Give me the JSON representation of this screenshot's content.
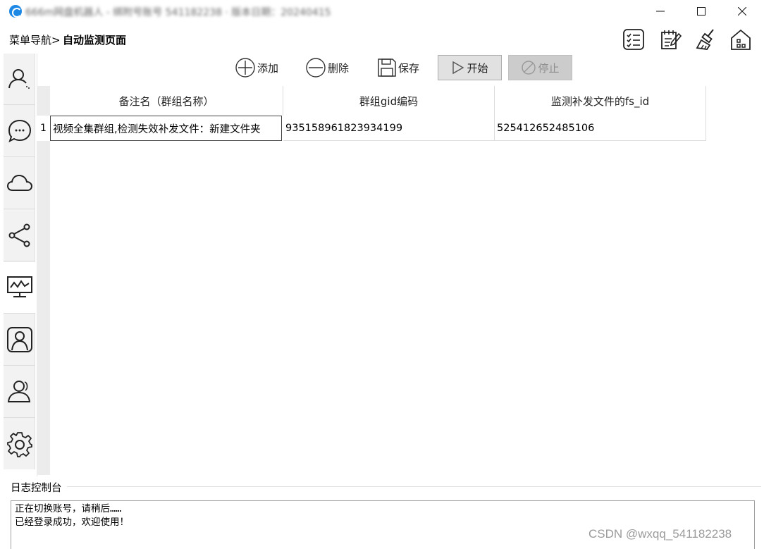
{
  "window": {
    "title": "666m网盘机器人 - 绑附号账号  541182238 · 版本日期：20240415"
  },
  "nav": {
    "breadcrumb_root": "菜单导航>",
    "breadcrumb_current": "自动监测页面"
  },
  "toolbar": {
    "add_label": "添加",
    "delete_label": "删除",
    "save_label": "保存",
    "start_label": "开始",
    "stop_label": "停止"
  },
  "table": {
    "columns": [
      "备注名（群组名称）",
      "群组gid编码",
      "监测补发文件的fs_id"
    ],
    "rows": [
      {
        "index": "1",
        "cells": [
          "视频全集群组,检测失效补发文件：新建文件夹",
          "935158961823934199",
          "525412652485106"
        ]
      }
    ]
  },
  "log": {
    "label": "日志控制台",
    "lines": [
      "正在切换账号，请稍后……",
      "已经登录成功，欢迎使用！"
    ]
  },
  "watermark": "CSDN @wxqq_541182238"
}
